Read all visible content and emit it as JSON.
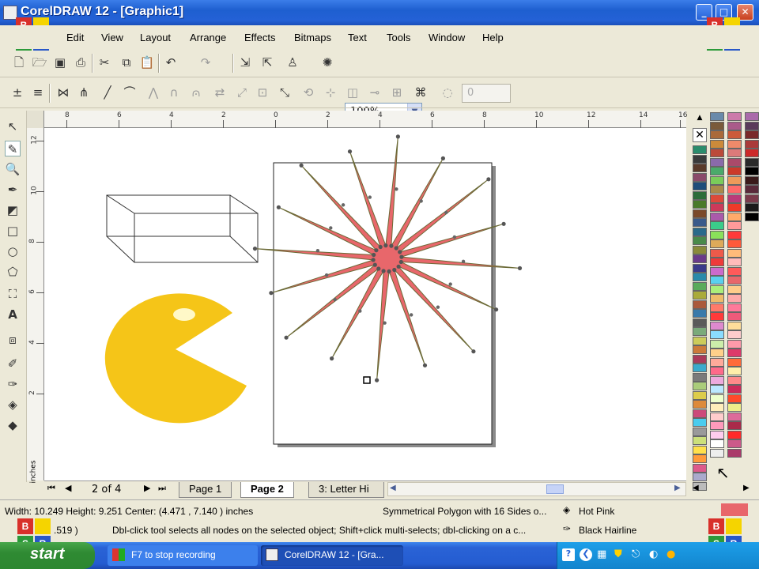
{
  "window": {
    "title": "CorelDRAW 12 - [Graphic1]"
  },
  "menu": [
    "Edit",
    "View",
    "Layout",
    "Arrange",
    "Effects",
    "Bitmaps",
    "Text",
    "Tools",
    "Window",
    "Help"
  ],
  "toolbar": {
    "zoom_value": "100%",
    "property_value": "0"
  },
  "logo": {
    "b": "B",
    "s": "S",
    "r": "R"
  },
  "ruler": {
    "horizontal": [
      "8",
      "6",
      "4",
      "2",
      "0",
      "2",
      "4",
      "6",
      "8",
      "10",
      "12",
      "14",
      "16"
    ],
    "vertical": [
      "12",
      "10",
      "8",
      "6",
      "4",
      "2"
    ],
    "unit": "inches"
  },
  "pages": {
    "counter": "2 of 4",
    "tabs": [
      "Page 1",
      "Page 2",
      "3: Letter Hi"
    ],
    "active": "Page 2"
  },
  "status": {
    "dims": "Width: 10.249  Height: 9.251  Center: (4.471 , 7.140 )  inches",
    "object": "Symmetrical Polygon with 16 Sides o...",
    "fill": "Hot Pink",
    "coords": ".519 )",
    "hint": "Dbl-click tool selects all nodes on the selected object; Shift+click multi-selects; dbl-clicking on a c...",
    "outline": "Black  Hairline"
  },
  "taskbar": {
    "start": "start",
    "items": [
      "F7 to stop recording",
      "CorelDRAW 12 - [Gra..."
    ]
  },
  "colors": {
    "star_fill": "#e8676b",
    "pacman": "#f5c518",
    "accent": "#2461d6"
  }
}
